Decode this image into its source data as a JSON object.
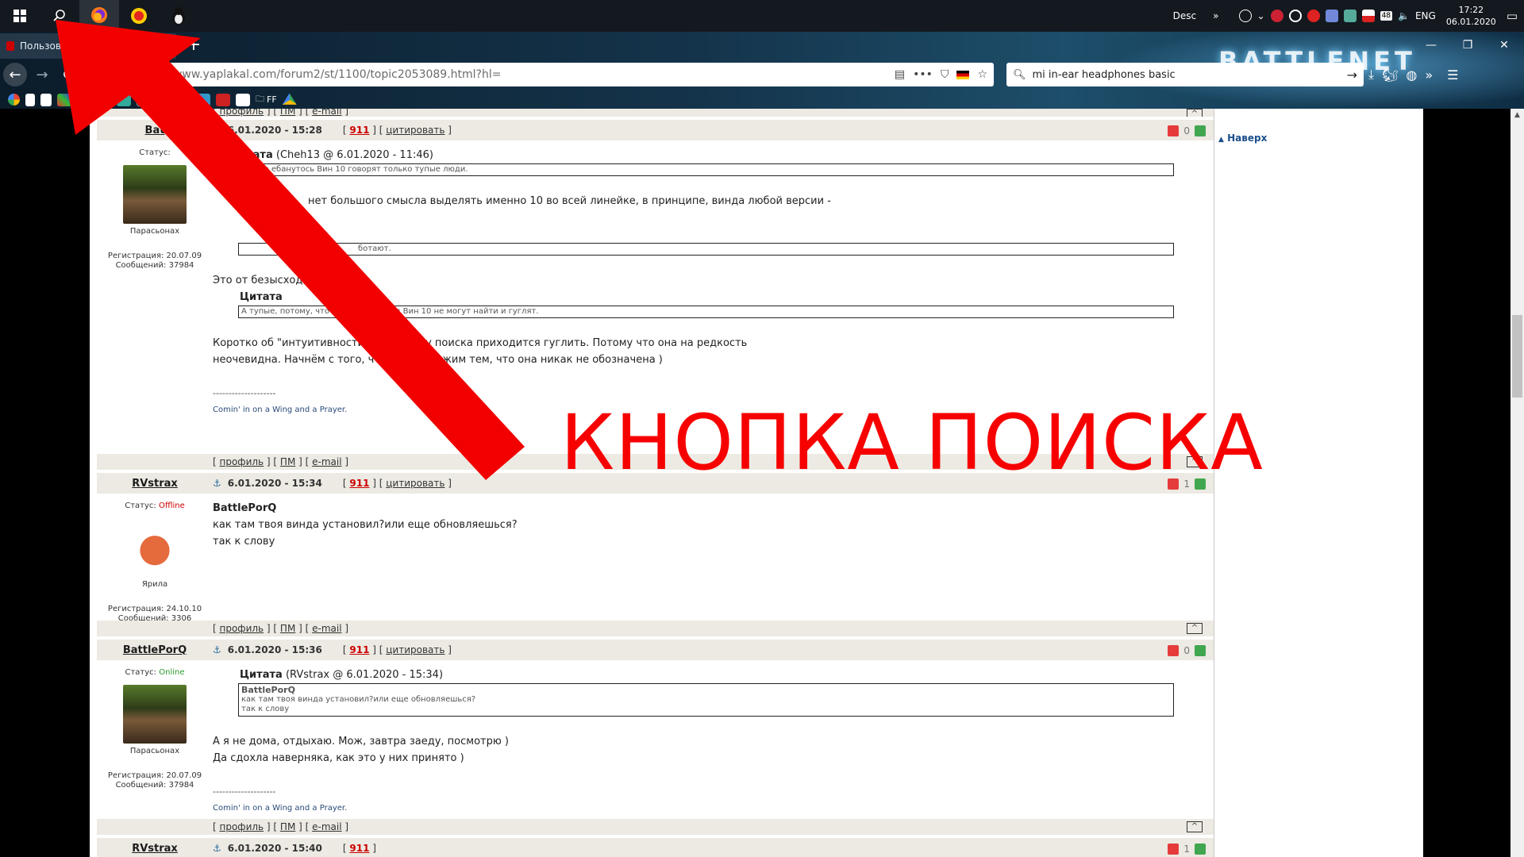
{
  "taskbar": {
    "user": "Desc",
    "language": "ENG",
    "time": "17:22",
    "date": "06.01.2020",
    "tray_chevron": "»",
    "tray_badge": "48"
  },
  "browser": {
    "tab_title": "Пользователи считают Windows…",
    "new_tab_label": "+",
    "url": "www.yaplakal.com/forum2/st/1100/topic2053089.html?hl=",
    "search_query": "mi in-ear headphones basic",
    "bookmarks_folder": "FF",
    "brand_text": "BATTLENET",
    "overflow_label": "»"
  },
  "forum": {
    "links": {
      "profile": "профиль",
      "pm": "ПМ",
      "email": "e-mail",
      "up": "^"
    },
    "back_to_top": "Наверх",
    "posts": [
      {
        "author": "BattlePorQ",
        "author_visible": "Bat",
        "date": "6.01.2020 - 15:28",
        "num": "911",
        "cite_label": "цитировать",
        "rating": "0",
        "status_label": "Статус:",
        "status": "",
        "avatar_caption": "Парасьонах",
        "reg": "Регистрация: 20.07.09",
        "msgs": "Сообщений: 37984",
        "quote1_title": "итата",
        "quote1_meta": "(Cheh13 @ 6.01.2020 - 11:46)",
        "quote1_text": "ал про ебанутось Вин 10 говорят только тупые люди.",
        "line1": "нет большого смысла выделять именно 10 во всей линейке, в принципе, винда любой версии -",
        "quote2_text": "ботают.",
        "line2": "Это от безысход",
        "quote3_title": "Цитата",
        "quote3_text": "А тупые, потому, что           кнопку поиска в Вин 10 не могут найти и гуглят.",
        "line3": "Коротко об \"интуитивности\"              Да, кнопку поиска приходится гуглить. Потому что она на редкость",
        "line4": "неочевидна. Начнём с того, что               а, продолжим тем, что она никак не обозначена )",
        "sig_line": "--------------------",
        "sig": "Comin' in on a Wing and a Prayer."
      },
      {
        "author": "RVstrax",
        "date": "6.01.2020 - 15:34",
        "num": "911",
        "cite_label": "цитировать",
        "rating": "1",
        "status_label": "Статус:",
        "status": "Offline",
        "avatar_caption": "Ярила",
        "reg": "Регистрация: 24.10.10",
        "msgs": "Сообщений: 3306",
        "addressee": "BattlePorQ",
        "line1": "как там твоя винда установил?или еще обновляешься?",
        "line2": "так к слову"
      },
      {
        "author": "BattlePorQ",
        "date": "6.01.2020 - 15:36",
        "num": "911",
        "cite_label": "цитировать",
        "rating": "0",
        "status_label": "Статус:",
        "status": "Online",
        "avatar_caption": "Парасьонах",
        "reg": "Регистрация: 20.07.09",
        "msgs": "Сообщений: 37984",
        "quote_title": "Цитата",
        "quote_meta": "(RVstrax @ 6.01.2020 - 15:34)",
        "quote_author": "BattlePorQ",
        "quote_line1": "как там твоя винда установил?или еще обновляешься?",
        "quote_line2": "так к слову",
        "line1": "А я не дома, отдыхаю. Мож, завтра заеду, посмотрю )",
        "line2": "Да сдохла наверняка, как это у них принято )",
        "sig_line": "--------------------",
        "sig": "Comin' in on a Wing and a Prayer."
      },
      {
        "author_visible": "RVstrax",
        "date": "6.01.2020 - 15:40",
        "num": "911",
        "rating": "1"
      }
    ]
  },
  "annotation": {
    "text": "КНОПКА ПОИСКА",
    "color": "#f60000"
  },
  "colors": {
    "taskbar_bg": "#14191f",
    "accent_red": "#c00000",
    "online_green": "#2a9a2a",
    "link_blue": "#1b4f8a"
  }
}
